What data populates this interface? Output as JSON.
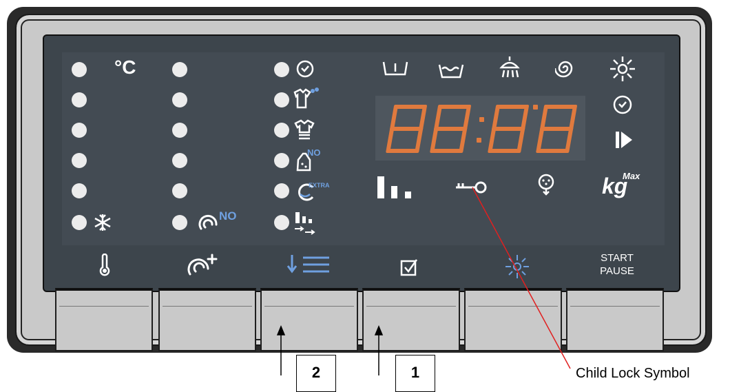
{
  "panel": {
    "temperature_unit": "°C",
    "start_pause": {
      "line1": "START",
      "line2": "PAUSE"
    },
    "max_load": {
      "unit": "kg",
      "superscript": "Max"
    },
    "display_digits": "88:88",
    "left_leds": {
      "count": 6,
      "bottom_icon": "snowflake-icon"
    },
    "middle_leds": {
      "count": 6,
      "bottom_icon": "spin-off-icon",
      "bottom_icon_label": "NO"
    },
    "option_leds": [
      {
        "icon": "delay-timer-icon"
      },
      {
        "icon": "stain-shirt-icon"
      },
      {
        "icon": "ironing-shirt-icon"
      },
      {
        "icon": "no-iron-icon",
        "label": "NO"
      },
      {
        "icon": "extra-rinse-icon",
        "label": "EXTRA"
      },
      {
        "icon": "load-level-icon"
      }
    ],
    "phase_icons": [
      "prewash-icon",
      "wash-icon",
      "rinse-icon",
      "spin-icon"
    ],
    "right_status_icons": [
      "steam-icon",
      "timer-icon",
      "play-icon",
      "max-kg-icon"
    ],
    "status_row": [
      "load-indicator-icon",
      "child-lock-key-icon",
      "drain-icon"
    ],
    "buttons": [
      {
        "icon": "thermometer-icon"
      },
      {
        "icon": "spin-speed-icon"
      },
      {
        "icon": "options-list-icon"
      },
      {
        "icon": "checkbox-icon"
      },
      {
        "icon": "steam-icon"
      },
      {
        "icon": "start-pause-icon"
      }
    ],
    "colors": {
      "segment": "#e07a3e",
      "accent_blue": "#6fa0e0",
      "panel": "#3d454c"
    }
  },
  "annotations": {
    "callout_2": "2",
    "callout_1": "1",
    "child_lock_label": "Child Lock Symbol"
  }
}
